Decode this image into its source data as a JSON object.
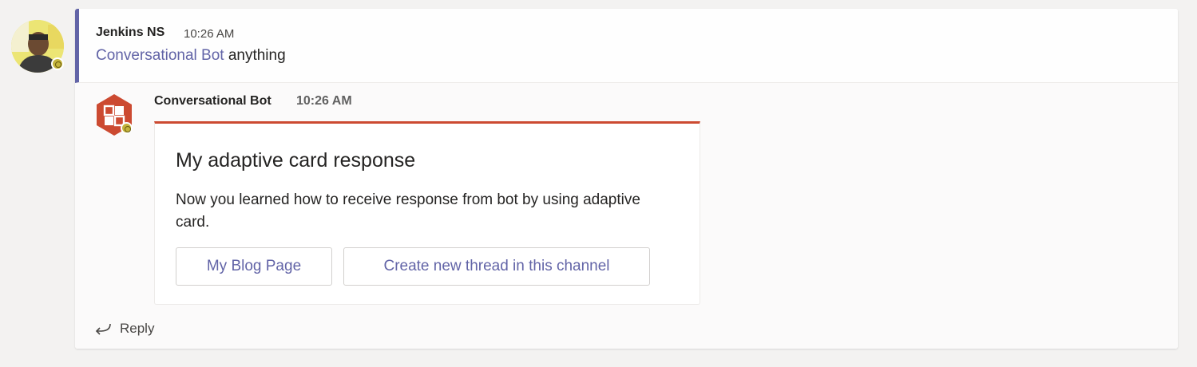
{
  "root_message": {
    "sender": "Jenkins NS",
    "time": "10:26 AM",
    "mention": "Conversational Bot",
    "text": " anything"
  },
  "bot_message": {
    "sender": "Conversational Bot",
    "time": "10:26 AM",
    "card": {
      "accent_color": "#cc4a31",
      "title": "My adaptive card response",
      "text": "Now you learned how to receive response from bot by using adaptive card.",
      "actions": [
        {
          "label": "My Blog Page"
        },
        {
          "label": "Create new thread in this channel"
        }
      ]
    }
  },
  "reply": {
    "label": "Reply",
    "icon": "reply-arrow-icon"
  },
  "colors": {
    "brand": "#6264a7",
    "presence": "#c4b43c",
    "bot_avatar": "#cc4a31"
  }
}
